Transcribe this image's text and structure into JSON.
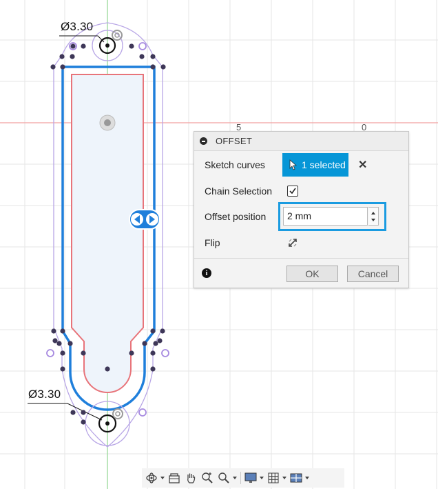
{
  "sketch": {
    "top_dimension": "Ø3.30",
    "bottom_dimension": "Ø3.30",
    "axis_tick_1": "5",
    "axis_tick_2": "0"
  },
  "offset_dialog": {
    "title": "OFFSET",
    "sketch_curves_label": "Sketch curves",
    "sketch_curves_value": "1 selected",
    "chain_selection_label": "Chain Selection",
    "chain_selection_checked": true,
    "offset_position_label": "Offset position",
    "offset_position_value": "2 mm",
    "flip_label": "Flip",
    "ok_label": "OK",
    "cancel_label": "Cancel"
  },
  "toolbar": {
    "items": [
      "orbit-icon",
      "look-at-icon",
      "pan-icon",
      "zoom-icon",
      "zoom-window-icon",
      "display-settings-icon",
      "grid-icon",
      "viewports-icon"
    ]
  },
  "colors": {
    "accent": "#0696d7",
    "offset_curve": "#1f7fdb",
    "original_curve": "#e8747a",
    "construction": "#b8a6e6",
    "grid": "#e6e6e6",
    "x_axis": "#f2a0a0",
    "y_axis": "#8fd68f"
  }
}
